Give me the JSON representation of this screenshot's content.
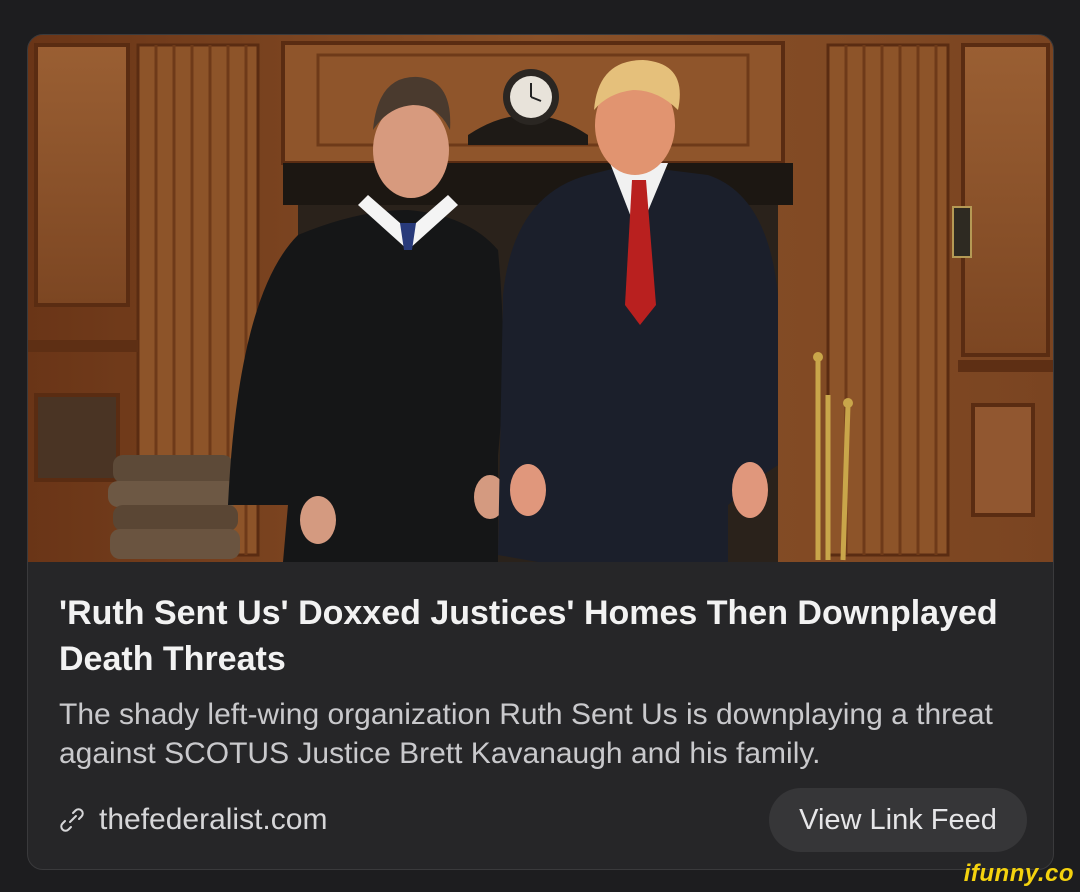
{
  "post": {
    "headline": "'Ruth Sent Us' Doxxed Justices' Homes Then Downplayed Death Threats",
    "summary": "The shady left-wing organization Ruth Sent Us is downplaying a threat against SCOTUS Justice Brett Kavanaugh and his family.",
    "source_domain": "thefederalist.com",
    "source_icon": "link-icon",
    "view_feed_label": "View Link Feed"
  },
  "watermark": {
    "text": "ifunny.co",
    "color": "#f4d20e"
  },
  "colors": {
    "background": "#1d1d1f",
    "card": "#262628",
    "headline": "#f2f2f2",
    "summary": "#c9c9cc",
    "button": "#363638"
  }
}
